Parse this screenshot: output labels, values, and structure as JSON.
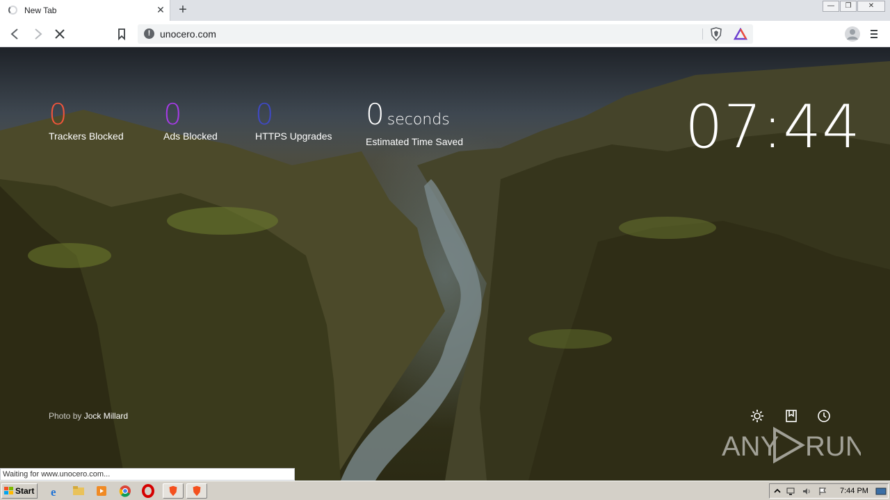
{
  "tab": {
    "title": "New Tab",
    "close": "✕",
    "new_tab": "+"
  },
  "window": {
    "min": "—",
    "max": "❐",
    "close": "✕"
  },
  "omnibox": {
    "url": "unocero.com"
  },
  "stats": {
    "trackers": {
      "value": "0",
      "label": "Trackers Blocked",
      "color": "#f2553b"
    },
    "ads": {
      "value": "0",
      "label": "Ads Blocked",
      "color": "#a53be5"
    },
    "https": {
      "value": "0",
      "label": "HTTPS Upgrades",
      "color": "#3f49c4"
    },
    "time": {
      "value": "0",
      "unit": "seconds",
      "label": "Estimated Time Saved",
      "color": "#ffffff"
    }
  },
  "clock": "07:44",
  "credit": {
    "prefix": "Photo by",
    "author": "Jock Millard"
  },
  "status": "Waiting for www.unocero.com...",
  "watermark": {
    "left": "ANY",
    "right": "RUN"
  },
  "taskbar": {
    "start": "Start",
    "time": "7:44 PM"
  },
  "icons": [
    "back-icon",
    "forward-icon",
    "stop-icon",
    "bookmark-icon",
    "info-icon",
    "brave-shield-icon",
    "brave-rewards-icon",
    "profile-icon",
    "menu-icon",
    "settings-icon",
    "bookmarks-icon",
    "history-icon"
  ]
}
